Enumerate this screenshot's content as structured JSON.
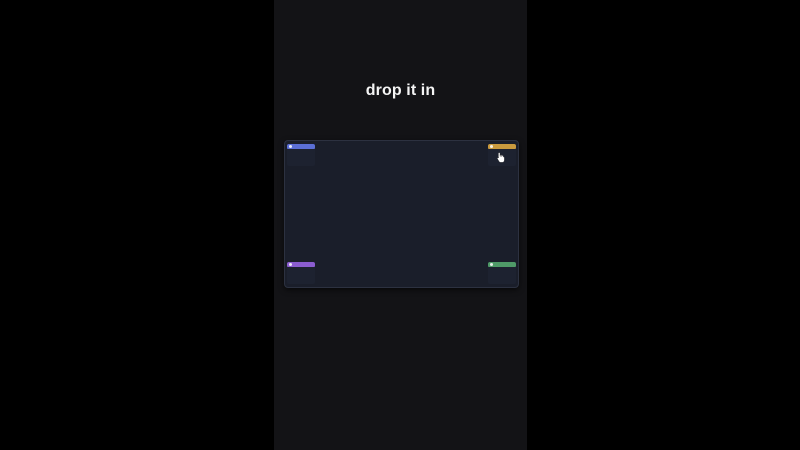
{
  "caption": "drop it in",
  "zones": [
    {
      "id": "top-left",
      "color": "#5b6fd6",
      "label": ""
    },
    {
      "id": "top-right",
      "color": "#c99a3e",
      "label": ""
    },
    {
      "id": "bottom-left",
      "color": "#8b5dd0",
      "label": ""
    },
    {
      "id": "bottom-right",
      "color": "#4f9a68",
      "label": ""
    }
  ],
  "cursor": {
    "icon": "hand-pointer-icon"
  },
  "colors": {
    "background": "#000000",
    "phone": "#131316",
    "board": "#1a1e2a"
  }
}
